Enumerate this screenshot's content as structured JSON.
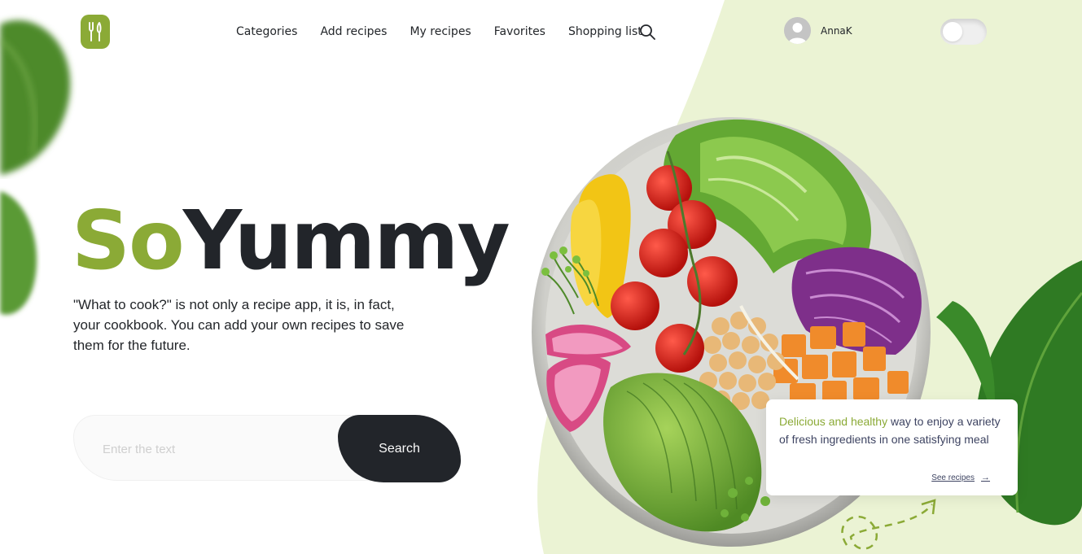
{
  "brand": {
    "accent": "#8baa36",
    "dark": "#22252a",
    "bg_light": "#ebf3d4"
  },
  "header": {
    "logo_icon": "fork-knife-icon",
    "nav": [
      {
        "label": "Categories"
      },
      {
        "label": "Add recipes"
      },
      {
        "label": "My recipes"
      },
      {
        "label": "Favorites"
      },
      {
        "label": "Shopping list"
      }
    ],
    "search_icon": "search-icon",
    "user": {
      "name": "AnnaK"
    },
    "theme_toggle": {
      "state": "off"
    }
  },
  "hero": {
    "title_part1": "So",
    "title_part2": "Yummy",
    "description": "\"What to cook?\" is not only a recipe app, it is, in fact, your cookbook. You can add your own recipes to save them for the future.",
    "search": {
      "placeholder": "Enter the text",
      "value": "",
      "button_label": "Search"
    }
  },
  "promo_card": {
    "accent_text": "Delicious and healthy",
    "text": " way to enjoy a variety of fresh ingredients in one satisfying meal",
    "link_label": "See recipes",
    "link_icon": "arrow-right-icon"
  }
}
